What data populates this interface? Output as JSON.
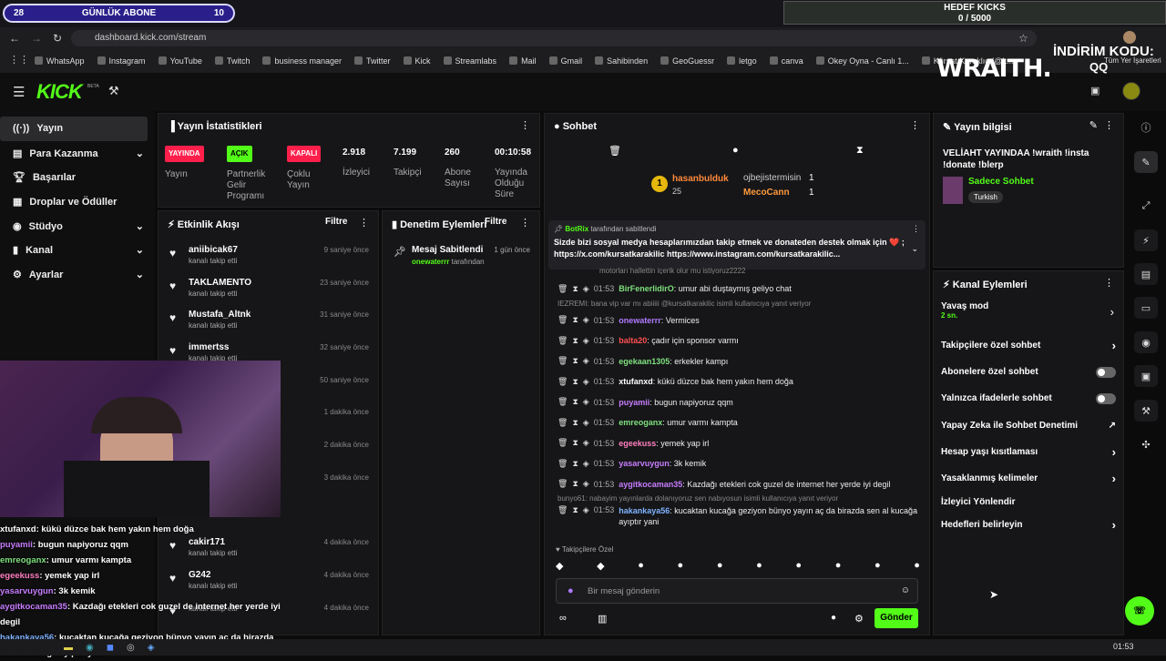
{
  "overlay": {
    "sub_left": "28",
    "sub_title": "GÜNLÜK ABONE",
    "sub_right": "10",
    "kick_goal_title": "HEDEF KICKS",
    "kick_goal_value": "0 / 5000",
    "promo_brand": "WRAITH.",
    "promo_label": "İNDİRİM KODU:",
    "promo_code": "QQ"
  },
  "browser": {
    "url": "dashboard.kick.com/stream",
    "bookmarks": [
      "WhatsApp",
      "Instagram",
      "YouTube",
      "Twitch",
      "business manager",
      "Twitter",
      "Kick",
      "Streamlabs",
      "Mail",
      "Gmail",
      "Sahibinden",
      "GeoGuessr",
      "letgo",
      "canva",
      "Okey Oyna - Canlı 1...",
      "Kürşat Karaklıç (@k...",
      "Tüm Yer İşaretleri"
    ]
  },
  "brand": {
    "name": "KICK",
    "beta": "BETA",
    "accent": "#53fc18"
  },
  "sidebar": {
    "items": [
      {
        "label": "Yayın"
      },
      {
        "label": "Para Kazanma"
      },
      {
        "label": "Başarılar"
      },
      {
        "label": "Droplar ve Ödüller"
      },
      {
        "label": "Stüdyo"
      },
      {
        "label": "Kanal"
      },
      {
        "label": "Ayarlar"
      }
    ]
  },
  "stats": {
    "title": "Yayın İstatistikleri",
    "live_badge": "YAYINDA",
    "live_label": "Yayın",
    "partner_badge": "AÇIK",
    "partner_label": "Partnerlik Gelir Programı",
    "multi_badge": "KAPALI",
    "multi_label": "Çoklu Yayın",
    "viewers": "2.918",
    "viewers_label": "İzleyici",
    "followers": "7.199",
    "followers_label": "Takipçi",
    "subs": "260",
    "subs_label": "Abone Sayısı",
    "duration": "00:10:58",
    "duration_label": "Yayında Olduğu Süre"
  },
  "activity": {
    "title": "Etkinlik Akışı",
    "filter": "Filtre",
    "events": [
      {
        "name": "aniibicak67",
        "sub": "kanalı takip etti",
        "time": "9 saniye önce"
      },
      {
        "name": "TAKLAMENTO",
        "sub": "kanalı takip etti",
        "time": "23 saniye önce"
      },
      {
        "name": "Mustafa_Altnk",
        "sub": "kanalı takip etti",
        "time": "31 saniye önce"
      },
      {
        "name": "immertss",
        "sub": "kanalı takip etti",
        "time": "32 saniye önce"
      },
      {
        "name": "",
        "sub": "",
        "time": "50 saniye önce"
      },
      {
        "name": "",
        "sub": "",
        "time": "1 dakika önce"
      },
      {
        "name": "",
        "sub": "",
        "time": "2 dakika önce"
      },
      {
        "name": "",
        "sub": "kanalı takip etti",
        "time": "3 dakika önce"
      },
      {
        "name": "",
        "sub": "kanalı takip etti",
        "time": ""
      },
      {
        "name": "cakir171",
        "sub": "kanalı takip etti",
        "time": "4 dakika önce"
      },
      {
        "name": "G242",
        "sub": "kanalı takip etti",
        "time": "4 dakika önce"
      },
      {
        "name": "",
        "sub": "kanalı takip etti",
        "time": "4 dakika önce"
      }
    ]
  },
  "moderation": {
    "title": "Denetim Eylemleri",
    "filter": "Filtre",
    "action": "Mesaj Sabitlendi",
    "time": "1 gün önce",
    "by_user": "onewaterrr",
    "by_suffix": "tarafından"
  },
  "chat": {
    "title": "Sohbet",
    "leader1": "hasanbulduk",
    "leader1_count": "25",
    "top1": "ojbejistermisin",
    "top1_count": "1",
    "top2": "MecoCann",
    "top2_count": "1",
    "pinned_by": "BotRix",
    "pinned_by_suffix": "tarafından sabitlendi",
    "pinned_text": "Sizde bizi sosyal medya hesaplarımızdan takip etmek ve donateden destek olmak için ❤️ ; https://x.com/kursatkarakilic https://www.instagram.com/kursatkarakilic...",
    "partial_line": "motorları hallettin içerik olur mu istiyoruz2222",
    "lines": [
      {
        "time": "01:53",
        "user": "BirFenerlidirO",
        "color": "#7ee07e",
        "text": "umur abi duştaymış geliyo chat"
      },
      {
        "reply": "IEZREMI: bana vip var mı abiiiii @kursatkarakilic isimli kullanıcıya yanıt veriyor"
      },
      {
        "time": "01:53",
        "user": "onewaterrr",
        "color": "#b07bff",
        "text": "Vermices"
      },
      {
        "time": "01:53",
        "user": "balta20",
        "color": "#ff5050",
        "text": "çadır için sponsor varmı"
      },
      {
        "time": "01:53",
        "user": "egekaan1305",
        "color": "#7ee07e",
        "text": "erkekler kampı"
      },
      {
        "time": "01:53",
        "user": "xtufanxd",
        "color": "#ffffff",
        "text": "kükü düzce bak hem yakın hem doğa"
      },
      {
        "time": "01:53",
        "user": "puyamii",
        "color": "#c77dff",
        "text": "bugun napiyoruz qqm"
      },
      {
        "time": "01:53",
        "user": "emreoganx",
        "color": "#7ee07e",
        "text": "umur varmı kampta"
      },
      {
        "time": "01:53",
        "user": "egeekuss",
        "color": "#ff7fbf",
        "text": "yemek yap irl"
      },
      {
        "time": "01:53",
        "user": "yasarvuygun",
        "color": "#c77dff",
        "text": "3k kemik"
      },
      {
        "time": "01:53",
        "user": "aygitkocaman35",
        "color": "#c77dff",
        "text": "Kazdağı etekleri cok guzel de internet her yerde iyi degil"
      },
      {
        "reply": "bunyo61: nabayim yayınlarda dolanıyoruz sen nabıyosun isimli kullanıcıya yanıt veriyor"
      },
      {
        "time": "01:53",
        "user": "hakankaya56",
        "color": "#7fb2ff",
        "text": "kucaktan kucağa geziyon bünyo yayın aç da birazda sen al kucağa ayıptır yani"
      }
    ],
    "followers_only": "Takipçilere Özel",
    "placeholder": "Bir mesaj gönderin",
    "send": "Gönder"
  },
  "stream_info": {
    "title": "Yayın bilgisi",
    "text": "VELİAHT YAYINDAA !wraith !insta !donate !blerp",
    "category": "Sadece Sohbet",
    "language": "Turkish"
  },
  "channel_actions": {
    "title": "Kanal Eylemleri",
    "slow_mode": "Yavaş mod",
    "slow_value": "2 sn.",
    "items": [
      "Takipçilere özel sohbet",
      "Abonelere özel sohbet",
      "Yalnızca ifadelerle sohbet",
      "Yapay Zeka ile Sohbet Denetimi",
      "Hesap yaşı kısıtlaması",
      "Yasaklanmış kelimeler",
      "İzleyici Yönlendir",
      "Hedefleri belirleyin"
    ]
  },
  "overlay_chat": [
    {
      "user": "xtufanxd",
      "color": "#fff",
      "text": ": kükü düzce bak hem yakın hem doğa"
    },
    {
      "user": "puyamii",
      "color": "#c77dff",
      "text": ": bugun napiyoruz qqm"
    },
    {
      "user": "emreoganx",
      "color": "#7ee07e",
      "text": ": umur varmı kampta"
    },
    {
      "user": "egeekuss",
      "color": "#ff7fbf",
      "text": ": yemek yap irl"
    },
    {
      "user": "yasarvuygun",
      "color": "#c77dff",
      "text": ": 3k kemik"
    },
    {
      "user": "aygitkocaman35",
      "color": "#c77dff",
      "text": ": Kazdağı etekleri cok guzel de internet her yerde iyi degil"
    },
    {
      "user": "hakankaya56",
      "color": "#7fb2ff",
      "text": ": kucaktan kucağa geziyon bünyo yayın aç da birazda sen al kucağa ayıptır yani"
    }
  ],
  "taskbar": {
    "clock": "01:53"
  }
}
